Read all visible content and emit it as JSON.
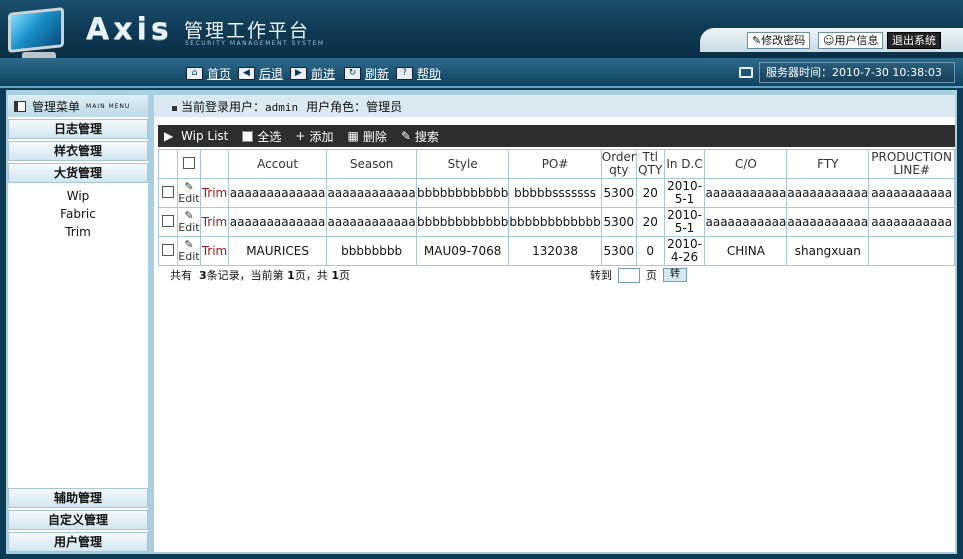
{
  "header": {
    "logo": "Axis",
    "title_cn": "管理工作平台",
    "subtitle": "SECURITY MANAGEMENT SYSTEM",
    "links": {
      "change_password": "修改密码",
      "user_info": "用户信息",
      "logout": "退出系统"
    }
  },
  "nav": {
    "items": [
      {
        "label": "首页",
        "icon": "home-icon"
      },
      {
        "label": "后退",
        "icon": "back-arrow-icon"
      },
      {
        "label": "前进",
        "icon": "forward-arrow-icon"
      },
      {
        "label": "刷新",
        "icon": "refresh-icon"
      },
      {
        "label": "帮助",
        "icon": "help-icon"
      }
    ],
    "server_time_label": "服务器时间：",
    "server_time": "2010-7-30 10:38:03"
  },
  "sidebar": {
    "title": "管理菜单",
    "title_en": "MAIN MENU",
    "groups": [
      "日志管理",
      "样衣管理",
      "大货管理"
    ],
    "sub_items": [
      "Wip",
      "Fabric",
      "Trim"
    ],
    "bottom_groups": [
      "辅助管理",
      "自定义管理",
      "用户管理"
    ]
  },
  "userbar": {
    "login_label": "当前登录用户：",
    "login_user": "admin",
    "role_label": "用户角色：",
    "role": "管理员"
  },
  "toolbar": {
    "title": "Wip List",
    "select_all": "全选",
    "add": "添加",
    "delete": "删除",
    "search": "搜索"
  },
  "table": {
    "headers": [
      "",
      "",
      "",
      "Accout",
      "Season",
      "Style",
      "PO#",
      "Order qty",
      "Ttl QTY",
      "In D.C",
      "C/O",
      "FTY",
      "PRODUCTION LINE#"
    ],
    "edit_label": "Edit",
    "trim_label": "Trim",
    "rows": [
      [
        "aaaaaaaaaaaaa",
        "aaaaaaaaaaaa",
        "bbbbbbbbbbbb",
        "bbbbbsssssss",
        "5300",
        "20",
        "2010-5-1",
        "aaaaaaaaaaa",
        "aaaaaaaaaaa",
        "aaaaaaaaaaa"
      ],
      [
        "aaaaaaaaaaaaa",
        "aaaaaaaaaaaa",
        "bbbbbbbbbbbb",
        "bbbbbbbbbbbb",
        "5300",
        "20",
        "2010-5-1",
        "aaaaaaaaaaa",
        "aaaaaaaaaaa",
        "aaaaaaaaaaa"
      ],
      [
        "MAURICES",
        "bbbbbbbb",
        "MAU09-7068",
        "132038",
        "5300",
        "0",
        "2010-4-26",
        "CHINA",
        "shangxuan",
        ""
      ]
    ]
  },
  "pagination": {
    "prefix": "共有",
    "total": "3",
    "records_label": "条记录，当前第",
    "current": "1",
    "page_of": "页，共",
    "pages": "1",
    "page_suffix": "页",
    "goto_label": "转到",
    "page_label": "页",
    "goto_button": "转"
  }
}
